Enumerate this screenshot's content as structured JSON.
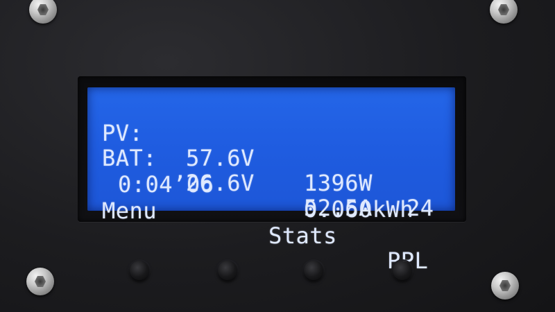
{
  "display": {
    "row1": {
      "label": "PV:",
      "voltage": "57.6V",
      "power": "1396W",
      "temp": "24"
    },
    "row2": {
      "label": "BAT:",
      "voltage": "26.6V",
      "current": "52.5A"
    },
    "row3": {
      "time": "0:04’06",
      "energy": "0.060kWh"
    },
    "row4": {
      "menu": "Menu",
      "stats": "Stats",
      "ppl": "PPL"
    }
  },
  "colors": {
    "lcd_background": "#2466e8",
    "lcd_text": "#dfe9ff",
    "panel": "#1c1c1f"
  }
}
